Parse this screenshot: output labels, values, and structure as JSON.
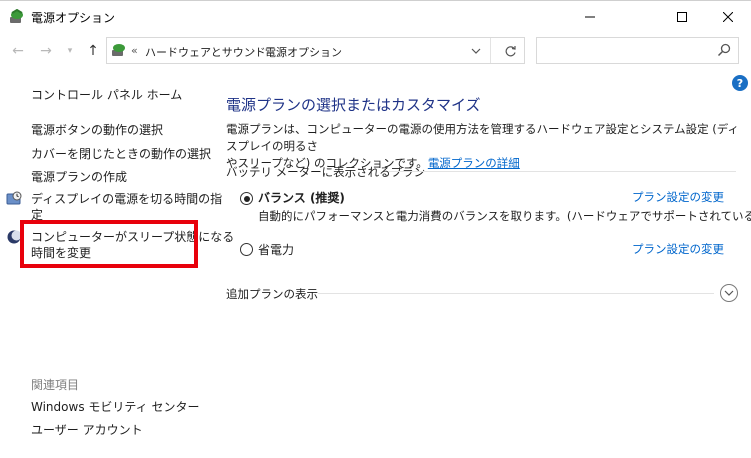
{
  "window": {
    "title": "電源オプション"
  },
  "address": {
    "separator": "«",
    "crumbs": [
      "ハードウェアとサウンド",
      "電源オプション"
    ],
    "crumb_sep": "›",
    "search_placeholder": ""
  },
  "help": {
    "label": "?"
  },
  "left": {
    "home": "コントロール パネル ホーム",
    "links": [
      "電源ボタンの動作の選択",
      "カバーを閉じたときの動作の選択",
      "電源プランの作成",
      "ディスプレイの電源を切る時間の指",
      "定",
      "コンピューターがスリープ状態になる",
      "時間を変更"
    ],
    "related_label": "関連項目",
    "related_links": [
      "Windows モビリティ センター",
      "ユーザー アカウント"
    ],
    "highlight_color": "#e8000b"
  },
  "main": {
    "title": "電源プランの選択またはカスタマイズ",
    "desc_line1": "電源プランは、コンピューターの電源の使用方法を管理するハードウェア設定とシステム設定 (ディスプレイの明るさ",
    "desc_line2": "やスリープなど) のコレクションです。",
    "desc_link": "電源プランの詳細",
    "section_label": "バッテリ メーターに表示されるプラン",
    "plans": [
      {
        "name": "バランス (推奨)",
        "selected": true,
        "description": "自動的にパフォーマンスと電力消費のバランスを取ります。(ハードウェアでサポートされている場合)",
        "link": "プラン設定の変更"
      },
      {
        "name": "省電力",
        "selected": false,
        "description": "",
        "link": "プラン設定の変更"
      }
    ],
    "more_plans_label": "追加プランの表示"
  },
  "colors": {
    "title_blue": "#1e3287",
    "link_blue": "#0066cc",
    "help_blue": "#1a6fc4"
  }
}
